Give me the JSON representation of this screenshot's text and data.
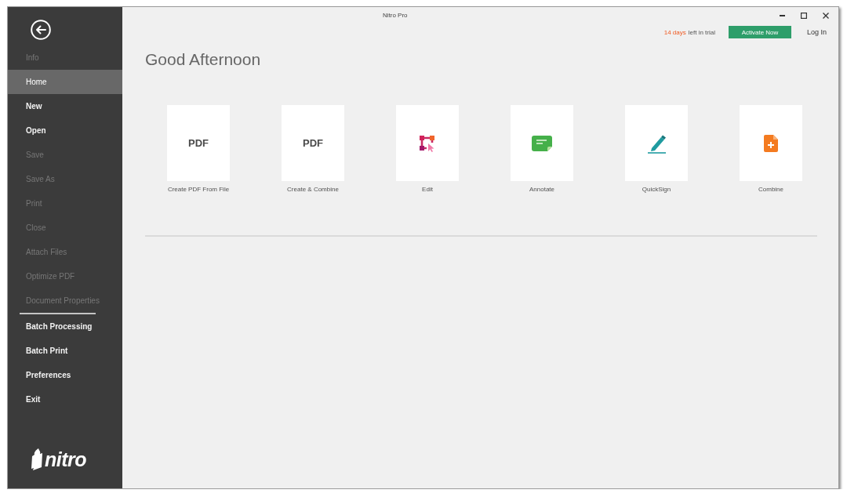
{
  "window": {
    "title": "Nitro Pro"
  },
  "sidebar": {
    "groups": [
      {
        "items": [
          {
            "label": "Info",
            "selected": false,
            "disabled": true
          },
          {
            "label": "Home",
            "selected": true,
            "disabled": false
          },
          {
            "label": "New",
            "selected": false,
            "disabled": false
          },
          {
            "label": "Open",
            "selected": false,
            "disabled": false
          },
          {
            "label": "Save",
            "selected": false,
            "disabled": true
          },
          {
            "label": "Save As",
            "selected": false,
            "disabled": true
          },
          {
            "label": "Print",
            "selected": false,
            "disabled": true
          },
          {
            "label": "Close",
            "selected": false,
            "disabled": true
          },
          {
            "label": "Attach Files",
            "selected": false,
            "disabled": true
          },
          {
            "label": "Optimize PDF",
            "selected": false,
            "disabled": true
          },
          {
            "label": "Document Properties",
            "selected": false,
            "disabled": true
          }
        ]
      },
      {
        "items": [
          {
            "label": "Batch Processing",
            "selected": false,
            "disabled": false
          },
          {
            "label": "Batch Print",
            "selected": false,
            "disabled": false
          },
          {
            "label": "Preferences",
            "selected": false,
            "disabled": false
          },
          {
            "label": "Exit",
            "selected": false,
            "disabled": false
          }
        ]
      }
    ],
    "logo": "nitro"
  },
  "header": {
    "trial_days": "14 days",
    "trial_text": "left in trial",
    "activate_button": "Activate Now",
    "login_link": "Log In"
  },
  "greeting": "Good Afternoon",
  "tiles": [
    {
      "kind": "pdf",
      "icon_text": "PDF",
      "label": "Create PDF From File"
    },
    {
      "kind": "pdf",
      "icon_text": "PDF",
      "label": "Create & Combine"
    },
    {
      "kind": "edit",
      "label": "Edit"
    },
    {
      "kind": "annotate",
      "label": "Annotate"
    },
    {
      "kind": "sign",
      "label": "QuickSign"
    },
    {
      "kind": "combine",
      "label": "Combine"
    }
  ]
}
